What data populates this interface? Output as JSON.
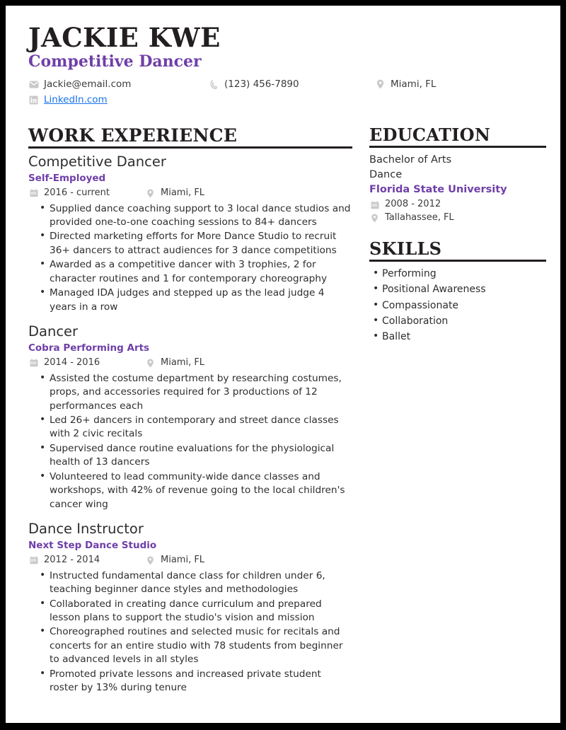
{
  "header": {
    "name": "JACKIE KWE",
    "title": "Competitive Dancer",
    "contacts": {
      "email": "Jackie@email.com",
      "phone": "(123) 456-7890",
      "location": "Miami, FL",
      "linkedin": "LinkedIn.com"
    }
  },
  "sections": {
    "work_experience_title": "WORK EXPERIENCE",
    "education_title": "EDUCATION",
    "skills_title": "SKILLS"
  },
  "work_experience": [
    {
      "title": "Competitive Dancer",
      "org": "Self-Employed",
      "dates": "2016 - current",
      "location": "Miami, FL",
      "bullets": [
        "Supplied dance coaching support to 3 local dance studios and provided one-to-one coaching sessions to 84+ dancers",
        "Directed marketing efforts for More Dance Studio to recruit 36+ dancers to attract audiences for 3 dance competitions",
        "Awarded as a competitive dancer with 3 trophies, 2 for character routines and 1 for contemporary choreography",
        "Managed IDA judges and stepped up as the lead judge 4 years in a row"
      ]
    },
    {
      "title": "Dancer",
      "org": "Cobra Performing Arts",
      "dates": "2014 - 2016",
      "location": "Miami, FL",
      "bullets": [
        "Assisted the costume department by researching costumes, props, and accessories required for 3 productions of 12 performances each",
        "Led 26+ dancers in contemporary and street dance classes with 2 civic recitals",
        "Supervised dance routine evaluations for the physiological health of 13 dancers",
        "Volunteered to lead community-wide dance classes and workshops, with 42% of revenue going to the local children's cancer wing"
      ]
    },
    {
      "title": "Dance Instructor",
      "org": "Next Step Dance Studio",
      "dates": "2012 - 2014",
      "location": "Miami, FL",
      "bullets": [
        "Instructed fundamental dance class for children under 6, teaching beginner dance styles and methodologies",
        "Collaborated in creating dance curriculum and prepared lesson plans to support the studio's vision and mission",
        "Choreographed routines and selected music for recitals and concerts for an entire studio with 78 students from beginner to advanced levels in all styles",
        "Promoted private lessons and increased private student roster by 13% during tenure"
      ]
    }
  ],
  "education": [
    {
      "degree": "Bachelor of Arts",
      "field": "Dance",
      "school": "Florida State University",
      "dates": "2008 - 2012",
      "location": "Tallahassee, FL"
    }
  ],
  "skills": [
    "Performing",
    "Positional Awareness",
    "Compassionate",
    "Collaboration",
    "Ballet"
  ],
  "colors": {
    "accent_purple": "#6f3fa8",
    "link_blue": "#1a73e8",
    "text_dark": "#2e2e2e",
    "rule_black": "#231f20",
    "icon_gray": "#c4c4c4",
    "frame_black": "#000000"
  }
}
